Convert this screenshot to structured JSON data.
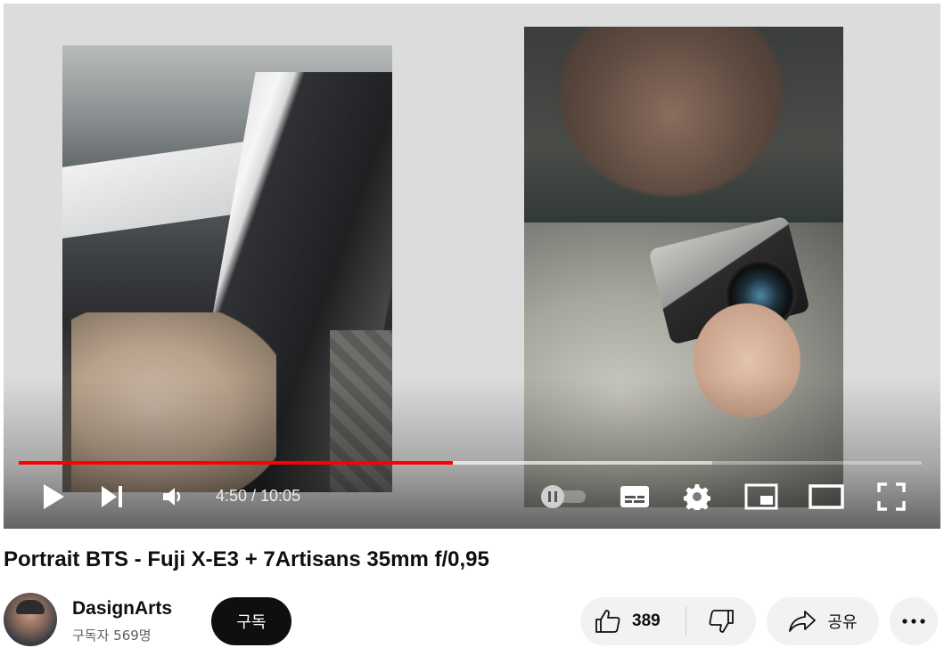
{
  "player": {
    "current_time": "4:50",
    "separator": "/",
    "duration": "10:05",
    "time_display": "4:50 / 10:05",
    "progress_played_fraction": 0.4805,
    "progress_buffered_fraction": 0.7681,
    "autoplay_on": false,
    "accent_color": "#ff0000",
    "icons": [
      "play-icon",
      "next-icon",
      "volume-icon",
      "autoplay-toggle",
      "subtitles-icon",
      "settings-gear-icon",
      "miniplayer-icon",
      "theater-mode-icon",
      "fullscreen-icon"
    ]
  },
  "video": {
    "title": "Portrait BTS - Fuji X-E3 + 7Artisans 35mm f/0,95"
  },
  "channel": {
    "name": "DasignArts",
    "subscribers": "구독자 569명",
    "subscribe_label": "구독"
  },
  "actions": {
    "like_count": "389",
    "share_label": "공유",
    "icons": [
      "thumbs-up-icon",
      "thumbs-down-icon",
      "share-arrow-icon",
      "more-dots-icon"
    ]
  }
}
